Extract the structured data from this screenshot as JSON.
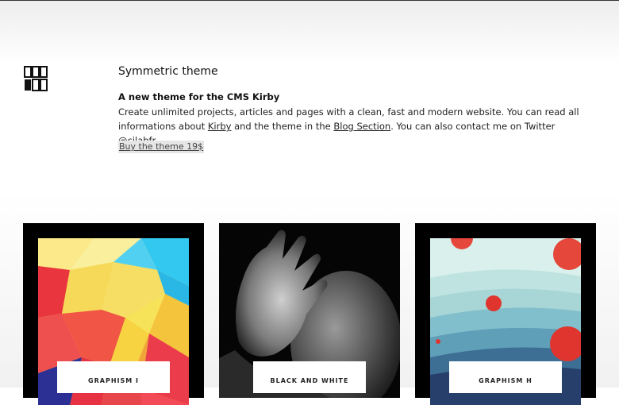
{
  "header": {
    "title": "Symmetric theme",
    "subtitle": "A new theme for the CMS Kirby",
    "desc_1": "Create unlimited projects, articles and pages with a clean, fast and modern website. You can read all informations about ",
    "link_kirby": "Kirby",
    "desc_2": " and the theme in the ",
    "link_blog": "Blog Section",
    "desc_3": ". You can also contact me on Twitter ",
    "link_twitter": "@cjlabfr",
    "desc_4": ".",
    "buy_label": "Buy the theme 19$"
  },
  "projects": [
    {
      "label": "GRAPHISM I"
    },
    {
      "label": "BLACK AND WHITE"
    },
    {
      "label": "GRAPHISM H"
    }
  ],
  "colors": {
    "card_frame": "#000000",
    "accent_red": "#e8323a",
    "accent_yellow": "#f7e35a",
    "accent_blue": "#2ec3ee"
  }
}
